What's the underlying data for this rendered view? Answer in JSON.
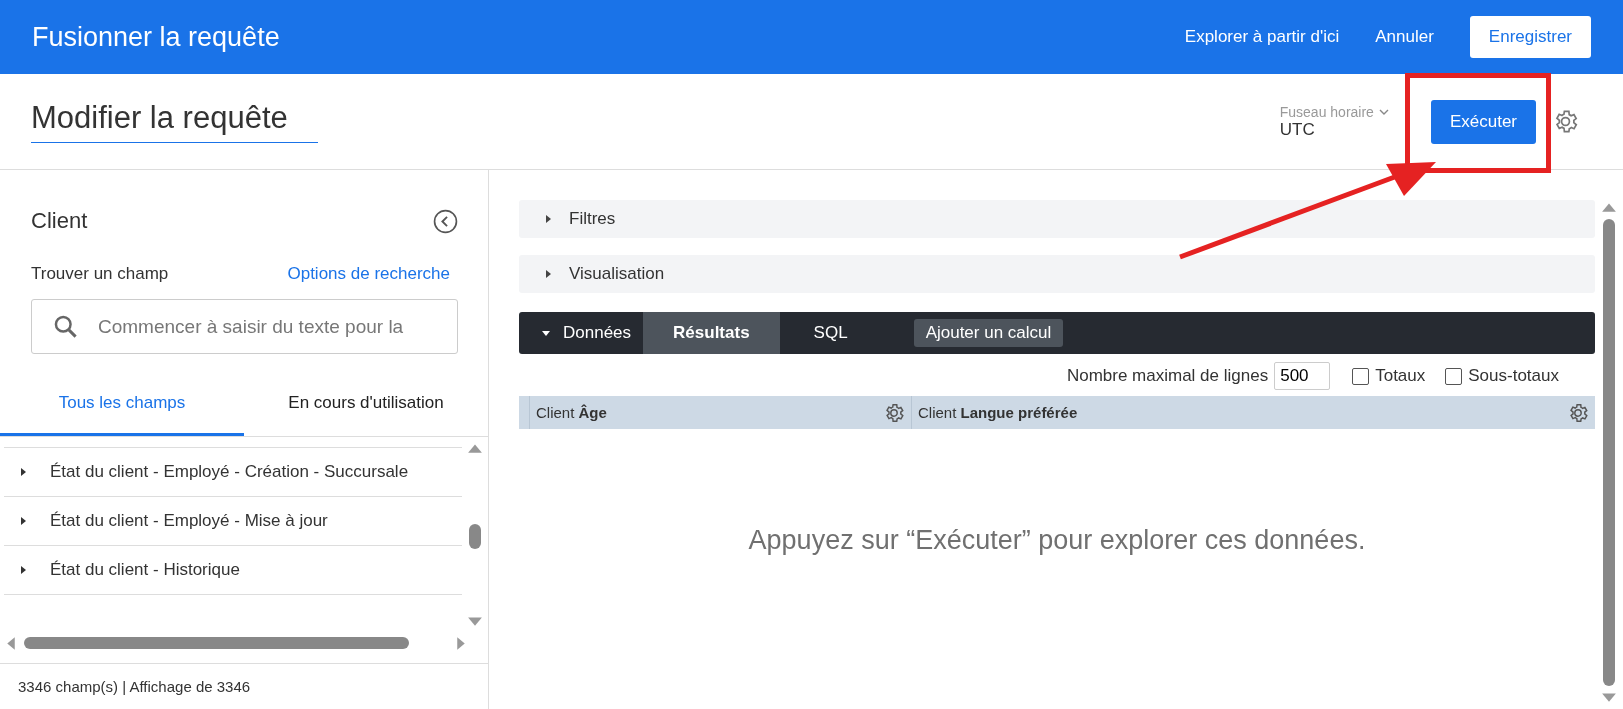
{
  "header": {
    "title": "Fusionner la requête",
    "links": [
      "Explorer à partir d'ici",
      "Annuler"
    ],
    "save_button": "Enregistrer"
  },
  "query_title": "Modifier la requête",
  "timezone": {
    "label": "Fuseau horaire",
    "value": "UTC"
  },
  "run_button": "Exécuter",
  "field_picker": {
    "title": "Client",
    "find_label": "Trouver un champ",
    "search_options": "Options de recherche",
    "search": {
      "placeholder": "Commencer à saisir du texte pour la"
    },
    "tabs": [
      {
        "label": "Tous les champs",
        "selected": true
      },
      {
        "label": "En cours d'utilisation",
        "selected": false
      }
    ],
    "items": [
      {
        "label": "État du client - Employé - Création - Succursale",
        "expanded": false
      },
      {
        "label": "État du client - Employé - Mise à jour",
        "expanded": false
      },
      {
        "label": "État du client - Historique",
        "expanded": false
      }
    ],
    "footer": "3346 champ(s) | Affichage de 3346"
  },
  "sections": [
    {
      "label": "Filtres",
      "expanded": false
    },
    {
      "label": "Visualisation",
      "expanded": false
    }
  ],
  "data_panel": {
    "label": "Données",
    "expanded": true,
    "tabs": [
      {
        "label": "Résultats",
        "selected": true
      },
      {
        "label": "SQL",
        "selected": false
      }
    ],
    "add_calc": "Ajouter un calcul",
    "row_limit": {
      "label": "Nombre maximal de lignes",
      "value": "500"
    },
    "options": [
      {
        "label": "Totaux",
        "checked": false
      },
      {
        "label": "Sous-totaux",
        "checked": false
      }
    ],
    "columns": [
      "Client **Âge**",
      "Client **Langue préférée**"
    ],
    "message": "Appuyez sur “Exécuter” pour explorer ces données."
  }
}
